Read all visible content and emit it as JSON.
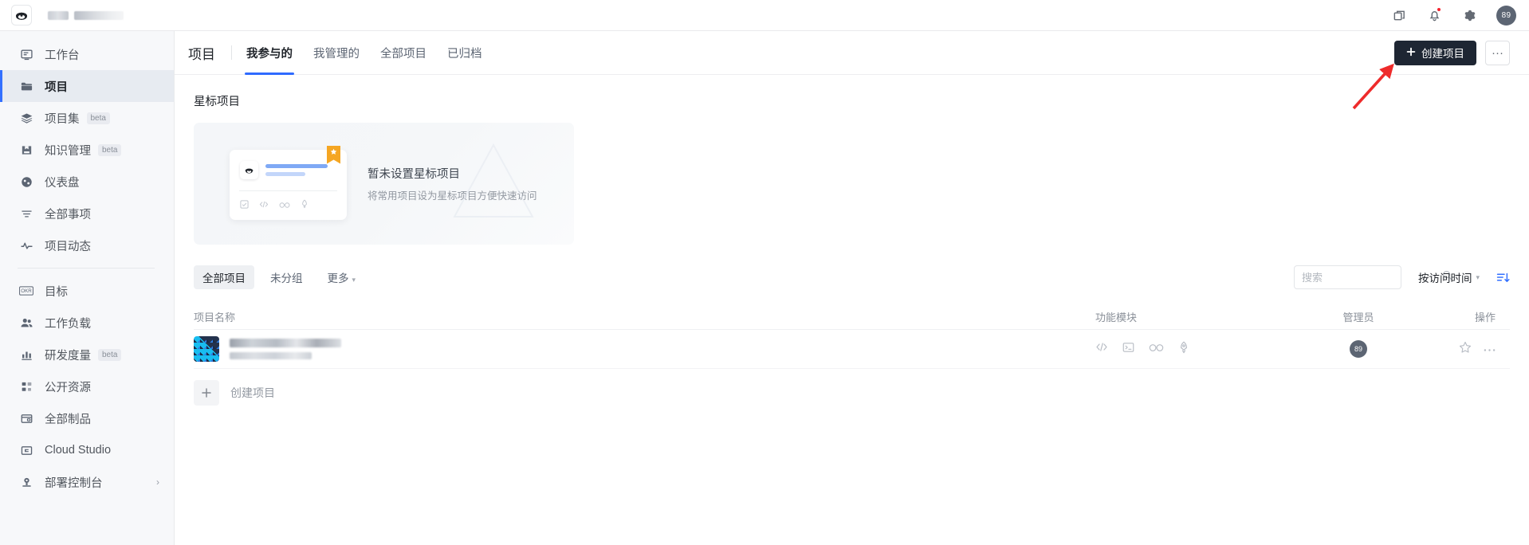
{
  "topbar": {
    "logo_icon": "coding-logo-icon",
    "org_name_redacted": "",
    "icons": [
      {
        "name": "copy-window-icon",
        "label": "多窗口"
      },
      {
        "name": "notification-bell-icon",
        "label": "通知",
        "has_unread_dot": true
      },
      {
        "name": "gear-icon",
        "label": "设置"
      }
    ],
    "avatar_text": "89"
  },
  "sidebar": {
    "items": [
      {
        "label": "工作台",
        "icon": "workbench-icon",
        "active": false
      },
      {
        "label": "项目",
        "icon": "folder-icon",
        "active": true
      },
      {
        "label": "项目集",
        "icon": "layers-icon",
        "active": false,
        "tag": "beta"
      },
      {
        "label": "知识管理",
        "icon": "book-save-icon",
        "active": false,
        "tag": "beta"
      },
      {
        "label": "仪表盘",
        "icon": "dashboard-icon",
        "active": false
      },
      {
        "label": "全部事项",
        "icon": "filter-list-icon",
        "active": false
      },
      {
        "label": "项目动态",
        "icon": "activity-pulse-icon",
        "active": false
      },
      {
        "label": "目标",
        "icon": "okr-icon",
        "active": false,
        "separator_before": true
      },
      {
        "label": "工作负载",
        "icon": "people-icon",
        "active": false
      },
      {
        "label": "研发度量",
        "icon": "bar-chart-icon",
        "active": false,
        "tag": "beta"
      },
      {
        "label": "公开资源",
        "icon": "grid-icon",
        "active": false
      },
      {
        "label": "全部制品",
        "icon": "artifact-box-icon",
        "active": false
      },
      {
        "label": "Cloud Studio",
        "icon": "cloud-studio-icon",
        "active": false
      },
      {
        "label": "部署控制台",
        "icon": "deploy-console-icon",
        "active": false,
        "chevron": "›"
      }
    ]
  },
  "header": {
    "title": "项目",
    "tabs": [
      {
        "label": "我参与的",
        "active": true
      },
      {
        "label": "我管理的",
        "active": false
      },
      {
        "label": "全部项目",
        "active": false
      },
      {
        "label": "已归档",
        "active": false
      }
    ],
    "create_button": {
      "label": "创建项目",
      "icon": "plus-icon",
      "color": "#1e2633"
    },
    "more_button": {
      "label": "···",
      "icon": "ellipsis-icon"
    }
  },
  "starred": {
    "section_title": "星标项目",
    "empty_title": "暂未设置星标项目",
    "empty_subtitle": "将常用项目设为星标项目方便快速访问",
    "card_icons": [
      "checkbox-icon",
      "code-icon",
      "pipeline-infinity-icon",
      "rocket-icon"
    ],
    "flag_icon": "star-flag-icon"
  },
  "filters": {
    "chips": [
      {
        "label": "全部项目",
        "active": true
      },
      {
        "label": "未分组",
        "active": false
      },
      {
        "label": "更多",
        "active": false,
        "caret": "▾"
      }
    ],
    "search": {
      "placeholder": "搜索",
      "value": "",
      "icon": "search-icon"
    },
    "sort": {
      "label": "按访问时间",
      "caret": "▾",
      "direction_icon": "sort-descending-icon",
      "accent": "#3370ff"
    }
  },
  "table": {
    "columns": [
      {
        "key": "name",
        "label": "项目名称"
      },
      {
        "key": "modules",
        "label": "功能模块"
      },
      {
        "key": "admin",
        "label": "管理员"
      },
      {
        "key": "ops",
        "label": "操作"
      }
    ],
    "rows": [
      {
        "name_redacted": true,
        "avatar_icon": "project-avatar-icon",
        "module_icons": [
          "code-icon",
          "terminal-icon",
          "pipeline-infinity-icon",
          "rocket-icon"
        ],
        "admin_avatar_text": "89",
        "ops_icons": [
          "star-outline-icon",
          "ellipsis-icon"
        ]
      }
    ],
    "create_row": {
      "label": "创建项目",
      "icon": "plus-icon"
    }
  },
  "annotation": {
    "arrow": {
      "color": "#ee2b2b",
      "points_to": "创建项目"
    }
  },
  "colors": {
    "accent_blue": "#3370ff",
    "dark_button": "#1e2633",
    "sidebar_bg": "#f7f8fa",
    "star_orange": "#f5a623",
    "notification_red": "#f5222d"
  }
}
